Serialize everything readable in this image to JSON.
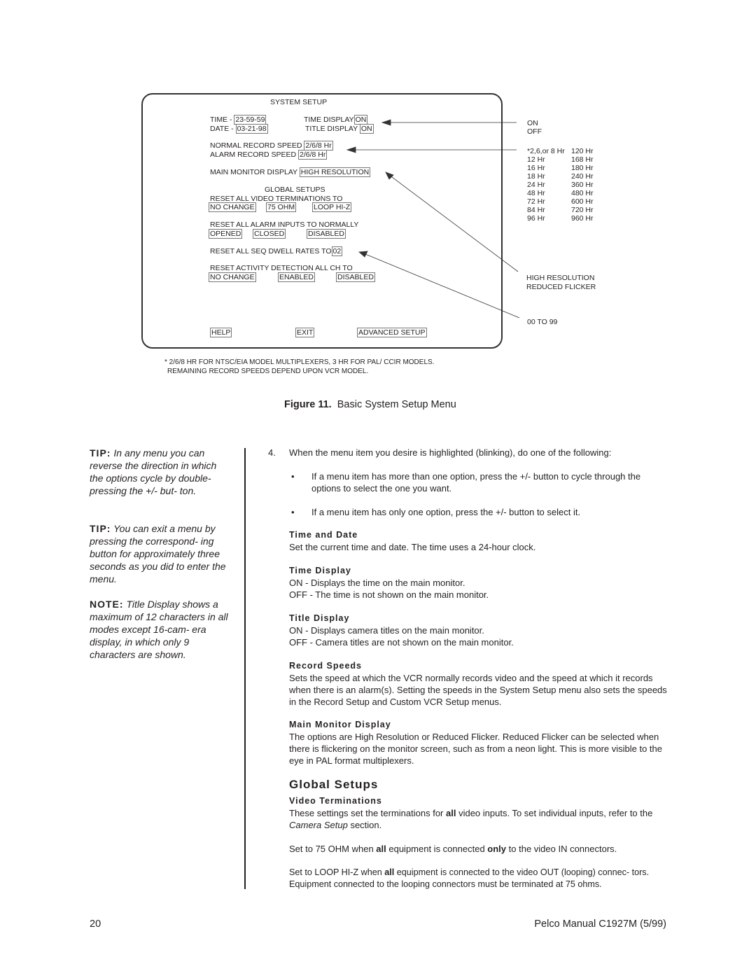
{
  "figure": {
    "menu_title": "SYSTEM SETUP",
    "time_label": "TIME -",
    "time_value": "23-59-59",
    "date_label": "DATE -",
    "date_value": "03-21-98",
    "time_display_label": "TIME DISPLAY",
    "time_display_value": "ON",
    "title_display_label": "TITLE DISPLAY",
    "title_display_value": "ON",
    "normal_speed_label": "NORMAL RECORD SPEED",
    "normal_speed_value": "2/6/8 Hr",
    "alarm_speed_label": "ALARM RECORD SPEED",
    "alarm_speed_value": "2/6/8 Hr",
    "main_monitor_label": "MAIN MONITOR DISPLAY",
    "main_monitor_value": "HIGH RESOLUTION",
    "global_title": "GLOBAL SETUPS",
    "video_term_label": "RESET ALL VIDEO TERMINATIONS TO",
    "video_term_options": [
      "NO CHANGE",
      "75 OHM",
      "LOOP HI-Z"
    ],
    "alarm_inputs_label": "RESET ALL ALARM INPUTS TO NORMALLY",
    "alarm_inputs_options": [
      "OPENED",
      "CLOSED",
      "DISABLED"
    ],
    "dwell_label": "RESET ALL SEQ  DWELL RATES TO",
    "dwell_value": "02",
    "activity_label": "RESET ACTIVITY DETECTION ALL CH TO",
    "activity_options": [
      "NO CHANGE",
      "ENABLED",
      "DISABLED"
    ],
    "buttons": [
      "HELP",
      "EXIT",
      "ADVANCED SETUP"
    ],
    "callout_onoff": [
      "ON",
      "OFF"
    ],
    "speeds_left": [
      "*2,6,or 8 Hr",
      "12 Hr",
      "16 Hr",
      "18 Hr",
      "24 Hr",
      "48 Hr",
      "72 Hr",
      "84 Hr",
      "96 Hr"
    ],
    "speeds_right": [
      "120 Hr",
      "168 Hr",
      "180 Hr",
      "240 Hr",
      "360 Hr",
      "480 Hr",
      "600 Hr",
      "720 Hr",
      "960 Hr"
    ],
    "callout_monitor": [
      "HIGH RESOLUTION",
      "REDUCED FLICKER"
    ],
    "callout_dwell": "00 TO 99",
    "footnote1": "* 2/6/8 HR FOR NTSC/EIA MODEL MULTIPLEXERS, 3 HR FOR PAL/ CCIR MODELS.",
    "footnote2": "REMAINING RECORD SPEEDS DEPEND UPON VCR MODEL.",
    "caption_label": "Figure 11.",
    "caption_text": "Basic System Setup Menu"
  },
  "sidebar": [
    {
      "label": "TIP:",
      "text": "In any menu you can reverse the direction in which the options cycle by double-pressing the +/- but- ton."
    },
    {
      "label": "TIP:",
      "text": "You can exit a menu by pressing the correspond- ing button for  approximately three seconds as you did to enter the menu."
    },
    {
      "label": "NOTE:",
      "text": "Title Display shows a maximum of 12 characters in all modes except 16-cam- era display, in which only 9 characters are shown."
    }
  ],
  "main": {
    "step_num": "4.",
    "step_text": "When the menu item you desire is highlighted (blinking), do one of the following:",
    "bullet1": "If a menu item has more than one option, press the +/- button to cycle through the options to select the one you want.",
    "bullet2": "If a menu item has only one option, press the +/- button to select it.",
    "h_time_date": "Time and Date",
    "p_time_date": "Set the current time and date. The time uses a 24-hour clock.",
    "h_time_display": "Time Display",
    "p_time_display_on": "ON - Displays the time on the main monitor.",
    "p_time_display_off": "OFF - The time is not shown on the main monitor.",
    "h_title_display": "Title Display",
    "p_title_on": "ON - Displays camera titles on the main monitor.",
    "p_title_off": "OFF - Camera titles are not shown on the main monitor.",
    "h_record": "Record Speeds",
    "p_record": "Sets the speed at which the VCR normally records video and the speed at which it records when there is an alarm(s). Setting the speeds in the System Setup menu also sets the speeds in the Record Setup and Custom VCR Setup menus.",
    "h_monitor": "Main Monitor Display",
    "p_monitor": "The options are High Resolution or Reduced Flicker. Reduced Flicker can be selected when there is flickering on the monitor screen, such as from a neon light. This is more visible to the eye in PAL format multiplexers.",
    "h_global": "Global Setups",
    "h_video_term": "Video Terminations",
    "p_vt1_a": "These settings set the terminations for ",
    "p_vt1_b": "all",
    "p_vt1_c": " video inputs. To set individual inputs, refer to the ",
    "p_vt1_d": "Camera Setup",
    "p_vt1_e": " section.",
    "p_vt2_a": "Set to 75 OHM when ",
    "p_vt2_b": "all",
    "p_vt2_c": " equipment is connected ",
    "p_vt2_d": "only",
    "p_vt2_e": " to the video IN connectors.",
    "p_vt3_a": "Set to LOOP HI-Z when ",
    "p_vt3_b": "all",
    "p_vt3_c": " equipment is connected to the video OUT (looping) connec- tors. Equipment connected to the looping connectors must be terminated at 75 ohms."
  },
  "footer": {
    "page": "20",
    "manual": "Pelco Manual C1927M (5/99)"
  }
}
